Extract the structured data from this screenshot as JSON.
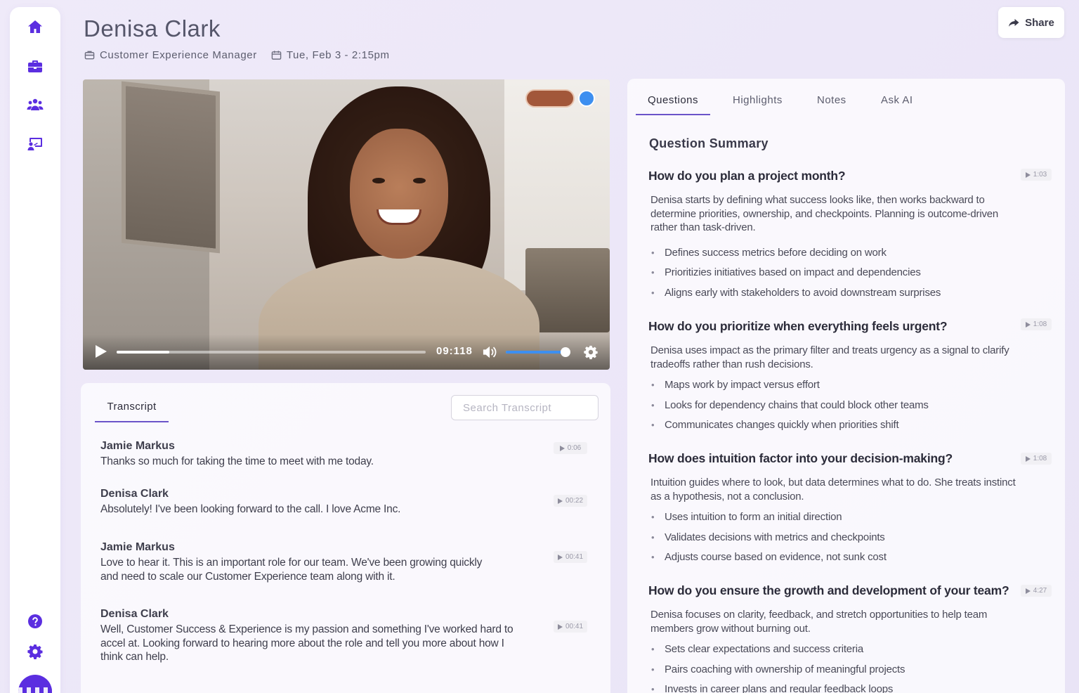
{
  "header": {
    "name": "Denisa Clark",
    "role": "Customer Experience Manager",
    "datetime": "Tue, Feb 3 - 2:15pm",
    "share_label": "Share"
  },
  "sidebar": {
    "items": [
      {
        "icon": "home-icon"
      },
      {
        "icon": "briefcase-icon"
      },
      {
        "icon": "users-icon"
      },
      {
        "icon": "presentation-icon"
      }
    ],
    "bottom": [
      {
        "icon": "help-icon"
      },
      {
        "icon": "settings-icon"
      }
    ]
  },
  "video": {
    "time": "09:1:18",
    "time_display": "09:118",
    "progress": 0.17,
    "volume": 0.92
  },
  "transcript": {
    "tab_label": "Transcript",
    "search_placeholder": "Search Transcript",
    "entries": [
      {
        "speaker": "Jamie Markus",
        "text": "Thanks so much for taking the time to meet with me today.",
        "time": "0:06"
      },
      {
        "speaker": "Denisa Clark",
        "text": "Absolutely! I've been looking forward to the call. I love Acme Inc.",
        "time": "00:22"
      },
      {
        "speaker": "Jamie Markus",
        "text": "Love to hear it. This is an important role for our team. We've been growing quickly and need to scale our Customer Experience team along with it.",
        "time": "00:41"
      },
      {
        "speaker": "Denisa Clark",
        "text": "Well, Customer Success & Experience is my passion and something I've worked hard to accel at. Looking forward to hearing more about the role and tell you more about how I think can help.",
        "time": "00:41"
      }
    ]
  },
  "questions_panel": {
    "tabs": [
      "Questions",
      "Highlights",
      "Notes",
      "Ask AI"
    ],
    "active_tab": "Questions",
    "summary_title": "Question Summary",
    "questions": [
      {
        "title": "How do you plan a project month?",
        "time": "1:03",
        "summary": "Denisa starts by defining what success looks like, then works backward to determine priorities, ownership, and checkpoints. Planning is outcome-driven rather than task-driven.",
        "bullets": [
          "Defines success metrics before deciding on work",
          "Prioritizies initiatives based on impact and dependencies",
          "Aligns early with stakeholders to avoid downstream surprises"
        ]
      },
      {
        "title": "How do you prioritize when everything feels urgent?",
        "time": "1:08",
        "summary": "Denisa uses impact as the primary filter and treats urgency as a signal to clarify tradeoffs rather than rush decisions.",
        "bullets": [
          "Maps work by impact versus effort",
          "Looks for dependency chains that could block other teams",
          "Communicates changes quickly when priorities shift"
        ]
      },
      {
        "title": "How does intuition factor into your decision-making?",
        "time": "1:08",
        "summary": "Intuition guides where to look, but data determines what to do. She treats instinct as a hypothesis, not a conclusion.",
        "bullets": [
          "Uses intuition to form an initial direction",
          "Validates decisions with metrics and checkpoints",
          "Adjusts course based on evidence, not sunk cost"
        ]
      },
      {
        "title": "How do you ensure the growth and development of your team?",
        "time": "4:27",
        "summary": "Denisa focuses on clarity, feedback, and stretch opportunities to help team members grow without burning out.",
        "bullets": [
          "Sets clear expectations and success criteria",
          "Pairs coaching with ownership of meaningful projects",
          "Invests in career plans and regular feedback loops"
        ]
      }
    ]
  }
}
